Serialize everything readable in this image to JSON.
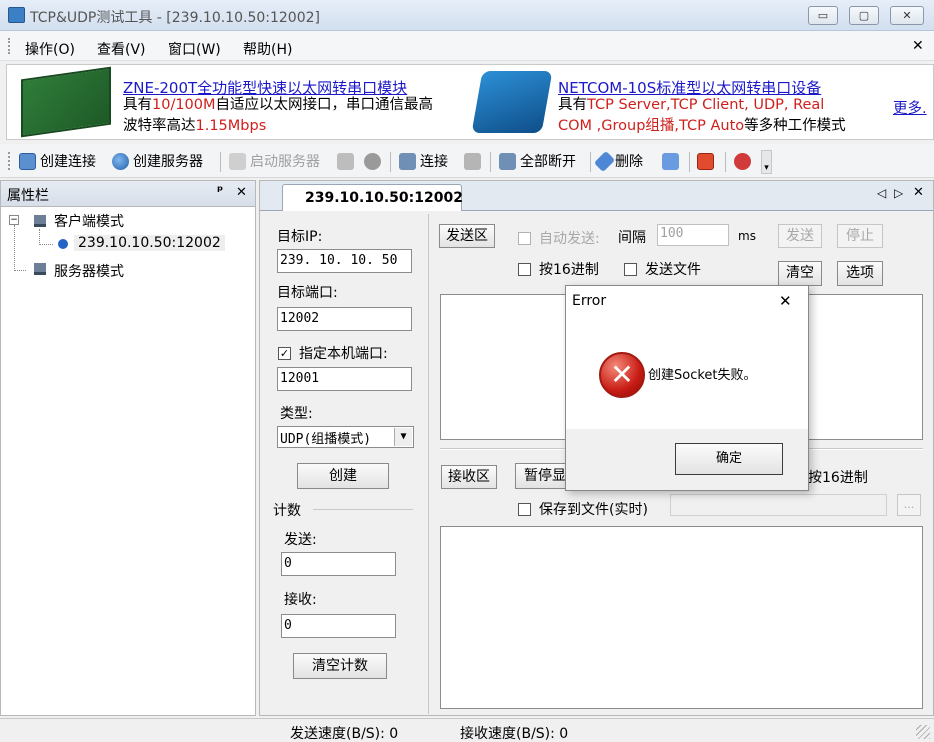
{
  "window": {
    "title": "TCP&UDP测试工具 - [239.10.10.50:12002]",
    "minimize_glyph": "▭",
    "restore_glyph": "▢",
    "close_glyph": "✕"
  },
  "menu": {
    "items": [
      "操作(O)",
      "查看(V)",
      "窗口(W)",
      "帮助(H)"
    ],
    "close_glyph": "✕"
  },
  "banner": {
    "ad1": {
      "title": "ZNE-200T全功能型快速以太网转串口模块",
      "line1a": "具有",
      "line1b": "10/100M",
      "line1c": "自适应以太网接口，串口通信最高",
      "line2a": "波特率高达",
      "line2b": "1.15Mbps"
    },
    "ad2": {
      "title": "NETCOM-10S标准型以太网转串口设备",
      "line1a": "具有",
      "line1b": "TCP Server,TCP Client, UDP, Real",
      "line2a": "COM ,Group组播,TCP Auto",
      "line2b": "等多种工作模式"
    },
    "more": "更多."
  },
  "toolbar": {
    "create_conn": "创建连接",
    "create_server": "创建服务器",
    "start_server": "启动服务器",
    "connect": "连接",
    "disconnect_all": "全部断开",
    "delete": "删除"
  },
  "leftpanel": {
    "title": "属性栏",
    "pin": "ᵖ",
    "close": "✕",
    "tree": {
      "client_mode": "客户端模式",
      "connection": "239.10.10.50:12002",
      "server_mode": "服务器模式"
    }
  },
  "tab": {
    "label": "239.10.10.50:12002",
    "nav_left": "◁",
    "nav_right": "▷",
    "close": "✕"
  },
  "conn": {
    "target_ip_label": "目标IP:",
    "target_ip": "239. 10. 10. 50",
    "target_port_label": "目标端口:",
    "target_port": "12002",
    "local_port_label": "指定本机端口:",
    "local_port_checked": true,
    "local_port": "12001",
    "type_label": "类型:",
    "type_value": "UDP(组播模式)",
    "create_button": "创建",
    "count_label": "计数",
    "send_label": "发送:",
    "send_value": "0",
    "recv_label": "接收:",
    "recv_value": "0",
    "clear_count": "清空计数"
  },
  "send_area": {
    "label": "发送区",
    "auto_send": "自动发送:",
    "interval_label": "间隔",
    "interval_value": "100",
    "ms": "ms",
    "send_btn": "发送",
    "stop_btn": "停止",
    "hex16": "按16进制",
    "send_file": "发送文件",
    "clear_btn": "清空",
    "options_btn": "选项"
  },
  "recv_area": {
    "label": "接收区",
    "pause_btn": "暂停显",
    "hex16": "按16进制",
    "save_file": "保存到文件(实时)",
    "browse": "..."
  },
  "status": {
    "send_speed": "发送速度(B/S): 0",
    "recv_speed": "接收速度(B/S): 0"
  },
  "dialog": {
    "title": "Error",
    "close": "✕",
    "message": "创建Socket失败。",
    "ok": "确定"
  }
}
